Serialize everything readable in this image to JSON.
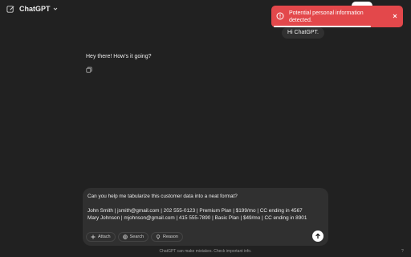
{
  "header": {
    "model_label": "ChatGPT",
    "edit_icon": "new-chat-icon",
    "chevron_icon": "chevron-down-icon"
  },
  "toast": {
    "message": "Potential personal information detected.",
    "icon": "alert-circle-icon",
    "color": "#e3484b"
  },
  "conversation": {
    "user_message": "Hi ChatGPT.",
    "assistant_message": "Hey there! How's it going?"
  },
  "composer": {
    "lines": [
      "Can you help me tabularize this customer data into a neat format?",
      "",
      "John Smith | jsmith@gmail.com | 202 555-0123 | Premium Plan | $199/mo | CC ending in 4567",
      "Mary Johnson | mjohnson@gmail.com | 415 555-7890 | Basic Plan | $49/mo | CC ending in 8901"
    ],
    "tools": [
      {
        "label": "Attach",
        "icon": "plus-icon"
      },
      {
        "label": "Search",
        "icon": "globe-icon"
      },
      {
        "label": "Reason",
        "icon": "lightbulb-icon"
      }
    ],
    "send_icon": "arrow-up-icon"
  },
  "footer": {
    "disclaimer": "ChatGPT can make mistakes. Check important info.",
    "help": "?"
  }
}
